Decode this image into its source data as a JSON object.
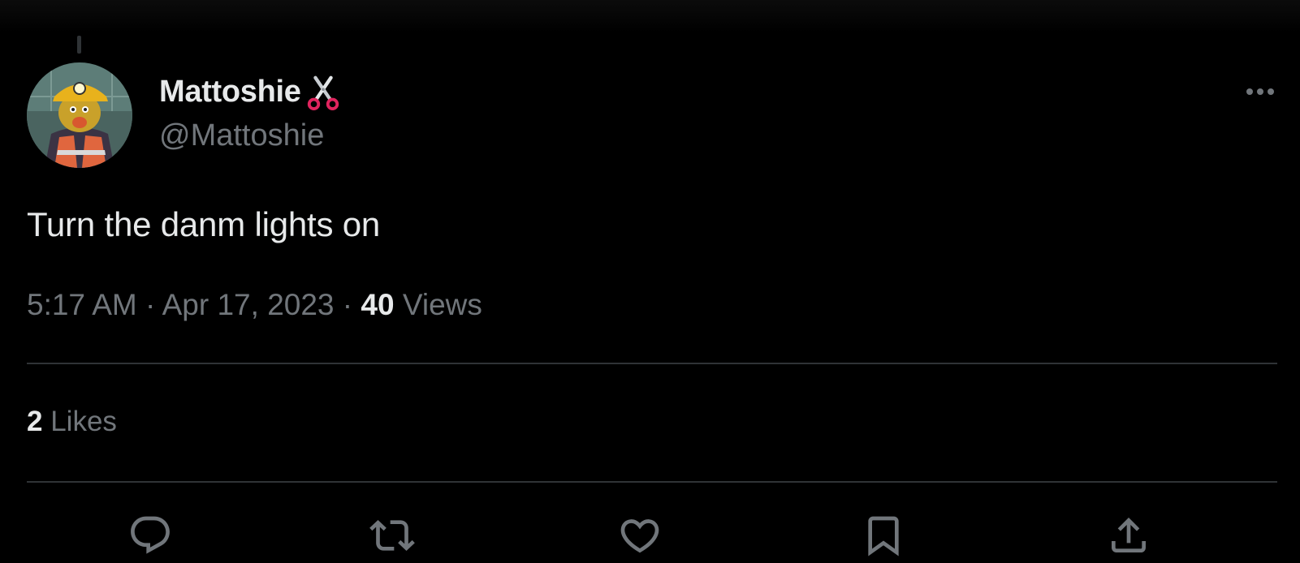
{
  "tweet": {
    "author": {
      "display_name": "Mattoshie",
      "name_emoji_icon": "scissors-icon",
      "handle": "@Mattoshie",
      "avatar_icon": "avatar-photo"
    },
    "text": "Turn the danm lights on",
    "time": "5:17 AM",
    "separator": "·",
    "date": "Apr 17, 2023",
    "views_count": "40",
    "views_label": "Views",
    "likes_count": "2",
    "likes_label": "Likes"
  },
  "actions": [
    {
      "name": "reply",
      "icon": "reply-icon"
    },
    {
      "name": "retweet",
      "icon": "retweet-icon"
    },
    {
      "name": "like",
      "icon": "heart-icon"
    },
    {
      "name": "bookmark",
      "icon": "bookmark-icon"
    },
    {
      "name": "share",
      "icon": "share-icon"
    }
  ],
  "colors": {
    "background": "#000000",
    "primary_text": "#e7e9ea",
    "secondary_text": "#71767b",
    "divider": "#2f3336"
  }
}
